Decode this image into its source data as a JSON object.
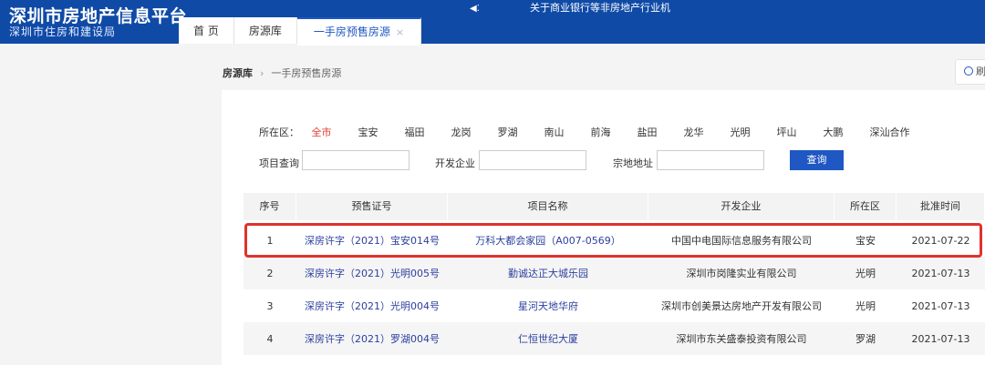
{
  "header": {
    "brand_title": "深圳市房地产信息平台",
    "brand_subtitle": "深圳市住房和建设局",
    "notice_icon": "speaker-icon",
    "notice_text": "关于商业银行等非房地产行业机",
    "tabs": [
      {
        "label": "首 页"
      },
      {
        "label": "房源库"
      },
      {
        "label": "一手房预售房源",
        "active": true
      }
    ],
    "tab_close_glyph": "×"
  },
  "breadcrumb": {
    "root": "房源库",
    "separator": "›",
    "current": "一手房预售房源"
  },
  "refresh": {
    "label": "刷"
  },
  "filters": {
    "district_label": "所在区：",
    "districts": [
      "全市",
      "宝安",
      "福田",
      "龙岗",
      "罗湖",
      "南山",
      "前海",
      "盐田",
      "龙华",
      "光明",
      "坪山",
      "大鹏",
      "深汕合作"
    ],
    "selected_district": "全市",
    "project_label": "项目查询",
    "project_value": "",
    "developer_label": "开发企业",
    "developer_value": "",
    "address_label": "宗地地址",
    "address_value": "",
    "search_label": "查询"
  },
  "table": {
    "columns": [
      "序号",
      "预售证号",
      "项目名称",
      "开发企业",
      "所在区",
      "批准时间"
    ],
    "rows": [
      {
        "no": "1",
        "permit": "深房许字（2021）宝安014号",
        "project": "万科大都会家园（A007-0569）",
        "developer": "中国中电国际信息服务有限公司",
        "district": "宝安",
        "date": "2021-07-22"
      },
      {
        "no": "2",
        "permit": "深房许字（2021）光明005号",
        "project": "勤诚达正大城乐园",
        "developer": "深圳市岗隆实业有限公司",
        "district": "光明",
        "date": "2021-07-13"
      },
      {
        "no": "3",
        "permit": "深房许字（2021）光明004号",
        "project": "星河天地华府",
        "developer": "深圳市创美景达房地产开发有限公司",
        "district": "光明",
        "date": "2021-07-13"
      },
      {
        "no": "4",
        "permit": "深房许字（2021）罗湖004号",
        "project": "仁恒世纪大厦",
        "developer": "深圳市东关盛泰投资有限公司",
        "district": "罗湖",
        "date": "2021-07-13"
      }
    ]
  },
  "colors": {
    "brand_blue": "#0f4aa6",
    "accent_blue": "#1f57c3",
    "selected_red": "#e03b2e",
    "highlight_red": "#e0322b",
    "link": "#2b3f9e"
  }
}
